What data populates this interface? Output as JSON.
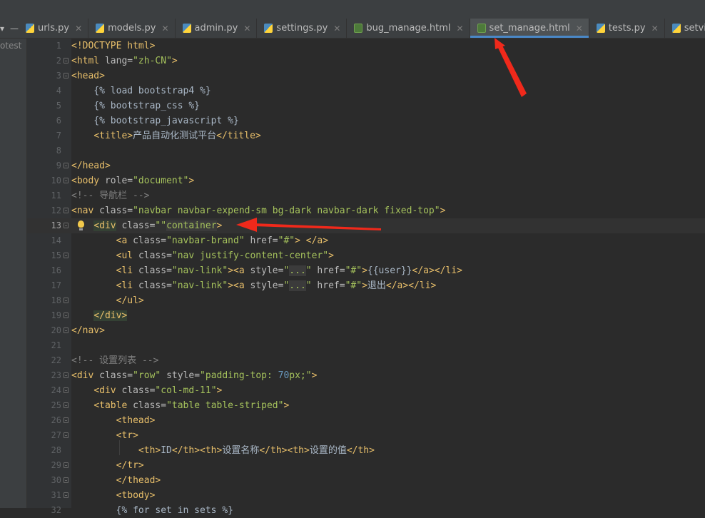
{
  "left_panel_label": "otest",
  "tab_controls": [
    "▾",
    "—"
  ],
  "tabs": [
    {
      "label": "urls.py",
      "icon": "python-file-icon",
      "active": false
    },
    {
      "label": "models.py",
      "icon": "python-file-icon",
      "active": false
    },
    {
      "label": "admin.py",
      "icon": "python-file-icon",
      "active": false
    },
    {
      "label": "settings.py",
      "icon": "python-file-icon",
      "active": false
    },
    {
      "label": "bug_manage.html",
      "icon": "html-file-icon",
      "active": false
    },
    {
      "label": "set_manage.html",
      "icon": "html-file-icon",
      "active": true
    },
    {
      "label": "tests.py",
      "icon": "python-file-icon",
      "active": false
    },
    {
      "label": "setviews.py",
      "icon": "python-file-icon",
      "active": false
    }
  ],
  "colors": {
    "editor_bg": "#2b2b2b",
    "tag": "#e8bf6a",
    "attribute": "#bababa",
    "string": "#a5c25c",
    "comment": "#808080",
    "active_tab_underline": "#4a88c7",
    "annotation_arrow": "#f0291b"
  },
  "code_lines": [
    {
      "n": "1",
      "tokens": [
        [
          "tag",
          "<!DOCTYPE html>"
        ]
      ]
    },
    {
      "n": "2",
      "fold": true,
      "tokens": [
        [
          "tag",
          "<html "
        ],
        [
          "attr",
          "lang="
        ],
        [
          "str",
          "\"zh-CN\""
        ],
        [
          "tag",
          ">"
        ]
      ]
    },
    {
      "n": "3",
      "fold": true,
      "tokens": [
        [
          "tag",
          "<head>"
        ]
      ]
    },
    {
      "n": "4",
      "tokens": [
        [
          "plain",
          "    {% load bootstrap4 %}"
        ]
      ]
    },
    {
      "n": "5",
      "tokens": [
        [
          "plain",
          "    {% bootstrap_css %}"
        ]
      ]
    },
    {
      "n": "6",
      "tokens": [
        [
          "plain",
          "    {% bootstrap_javascript %}"
        ]
      ]
    },
    {
      "n": "7",
      "tokens": [
        [
          "plain",
          "    "
        ],
        [
          "tag",
          "<title>"
        ],
        [
          "plain",
          "产品自动化测试平台"
        ],
        [
          "tag",
          "</title>"
        ]
      ]
    },
    {
      "n": "8",
      "tokens": []
    },
    {
      "n": "9",
      "fold": true,
      "tokens": [
        [
          "tag",
          "</head>"
        ]
      ]
    },
    {
      "n": "10",
      "fold": true,
      "tokens": [
        [
          "tag",
          "<body "
        ],
        [
          "attr",
          "role="
        ],
        [
          "str",
          "\"document\""
        ],
        [
          "tag",
          ">"
        ]
      ]
    },
    {
      "n": "11",
      "tokens": [
        [
          "cmt",
          "<!-- 导航栏 -->"
        ]
      ]
    },
    {
      "n": "12",
      "fold": true,
      "tokens": [
        [
          "tag",
          "<nav "
        ],
        [
          "attr",
          "class="
        ],
        [
          "str",
          "\"navbar navbar-expend-sm bg-dark navbar-dark fixed-top\""
        ],
        [
          "tag",
          ">"
        ]
      ]
    },
    {
      "n": "13",
      "fold": true,
      "current": true,
      "bulb": true,
      "tokens": [
        [
          "plain",
          "    "
        ],
        [
          "hl",
          "<div"
        ],
        [
          "attr",
          " class="
        ],
        [
          "str",
          "\"\""
        ],
        [
          "box",
          "container"
        ],
        [
          "tag",
          ">"
        ]
      ]
    },
    {
      "n": "14",
      "tokens": [
        [
          "plain",
          "        "
        ],
        [
          "tag",
          "<a "
        ],
        [
          "attr",
          "class="
        ],
        [
          "str",
          "\"navbar-brand\""
        ],
        [
          "attr",
          " href="
        ],
        [
          "str",
          "\"#\""
        ],
        [
          "tag",
          ">"
        ],
        [
          "plain",
          " "
        ],
        [
          "tag",
          "</a>"
        ]
      ]
    },
    {
      "n": "15",
      "fold": true,
      "tokens": [
        [
          "plain",
          "        "
        ],
        [
          "tag",
          "<ul "
        ],
        [
          "attr",
          "class="
        ],
        [
          "str",
          "\"nav justify-content-center\""
        ],
        [
          "tag",
          ">"
        ]
      ]
    },
    {
      "n": "16",
      "tokens": [
        [
          "plain",
          "        "
        ],
        [
          "tag",
          "<li "
        ],
        [
          "attr",
          "class="
        ],
        [
          "str",
          "\"nav-link\""
        ],
        [
          "tag",
          "><a "
        ],
        [
          "attr",
          "style="
        ],
        [
          "str",
          "\""
        ],
        [
          "box",
          "..."
        ],
        [
          "str",
          "\""
        ],
        [
          "attr",
          " href="
        ],
        [
          "str",
          "\"#\""
        ],
        [
          "tag",
          ">"
        ],
        [
          "plain",
          "{{user}}"
        ],
        [
          "tag",
          "</a></li>"
        ]
      ]
    },
    {
      "n": "17",
      "tokens": [
        [
          "plain",
          "        "
        ],
        [
          "tag",
          "<li "
        ],
        [
          "attr",
          "class="
        ],
        [
          "str",
          "\"nav-link\""
        ],
        [
          "tag",
          "><a "
        ],
        [
          "attr",
          "style="
        ],
        [
          "str",
          "\""
        ],
        [
          "box",
          "..."
        ],
        [
          "str",
          "\""
        ],
        [
          "attr",
          " href="
        ],
        [
          "str",
          "\"#\""
        ],
        [
          "tag",
          ">"
        ],
        [
          "plain",
          "退出"
        ],
        [
          "tag",
          "</a></li>"
        ]
      ]
    },
    {
      "n": "18",
      "fold": true,
      "tokens": [
        [
          "plain",
          "        "
        ],
        [
          "tag",
          "</ul>"
        ]
      ]
    },
    {
      "n": "19",
      "fold": true,
      "tokens": [
        [
          "plain",
          "    "
        ],
        [
          "hl",
          "</div>"
        ]
      ]
    },
    {
      "n": "20",
      "fold": true,
      "tokens": [
        [
          "tag",
          "</nav>"
        ]
      ]
    },
    {
      "n": "21",
      "tokens": []
    },
    {
      "n": "22",
      "tokens": [
        [
          "cmt",
          "<!-- 设置列表 -->"
        ]
      ]
    },
    {
      "n": "23",
      "fold": true,
      "tokens": [
        [
          "tag",
          "<div "
        ],
        [
          "attr",
          "class="
        ],
        [
          "str",
          "\"row\""
        ],
        [
          "attr",
          " style="
        ],
        [
          "str",
          "\"padding-top: "
        ],
        [
          "num",
          "70"
        ],
        [
          "str",
          "px;\""
        ],
        [
          "tag",
          ">"
        ]
      ]
    },
    {
      "n": "24",
      "fold": true,
      "tokens": [
        [
          "plain",
          "    "
        ],
        [
          "tag",
          "<div "
        ],
        [
          "attr",
          "class="
        ],
        [
          "str",
          "\"col-md-11\""
        ],
        [
          "tag",
          ">"
        ]
      ]
    },
    {
      "n": "25",
      "fold": true,
      "tokens": [
        [
          "plain",
          "    "
        ],
        [
          "tag",
          "<table "
        ],
        [
          "attr",
          "class="
        ],
        [
          "str",
          "\"table table-striped\""
        ],
        [
          "tag",
          ">"
        ]
      ]
    },
    {
      "n": "26",
      "fold": true,
      "tokens": [
        [
          "plain",
          "        "
        ],
        [
          "tag",
          "<thead>"
        ]
      ]
    },
    {
      "n": "27",
      "fold": true,
      "tokens": [
        [
          "plain",
          "        "
        ],
        [
          "tag",
          "<tr>"
        ]
      ]
    },
    {
      "n": "28",
      "tokens": [
        [
          "plain",
          "            "
        ],
        [
          "tag",
          "<th>"
        ],
        [
          "plain",
          "ID"
        ],
        [
          "tag",
          "</th><th>"
        ],
        [
          "plain",
          "设置名称"
        ],
        [
          "tag",
          "</th><th>"
        ],
        [
          "plain",
          "设置的值"
        ],
        [
          "tag",
          "</th>"
        ]
      ]
    },
    {
      "n": "29",
      "fold": true,
      "tokens": [
        [
          "plain",
          "        "
        ],
        [
          "tag",
          "</tr>"
        ]
      ]
    },
    {
      "n": "30",
      "fold": true,
      "tokens": [
        [
          "plain",
          "        "
        ],
        [
          "tag",
          "</thead>"
        ]
      ]
    },
    {
      "n": "31",
      "fold": true,
      "tokens": [
        [
          "plain",
          "        "
        ],
        [
          "tag",
          "<tbody>"
        ]
      ]
    },
    {
      "n": "32",
      "tokens": [
        [
          "plain",
          "        {% for set in sets %}"
        ]
      ]
    }
  ]
}
